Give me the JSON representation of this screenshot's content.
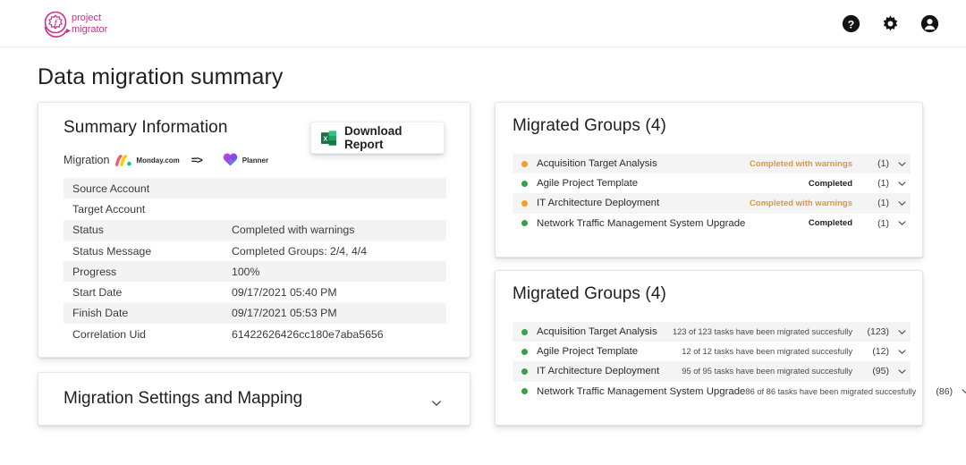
{
  "header": {
    "logo": {
      "line1": "project",
      "line2": "migrator",
      "color": "#cf2d87"
    },
    "icons": [
      {
        "name": "help-icon",
        "glyph": "?"
      },
      {
        "name": "gear-icon",
        "glyph": "gear"
      },
      {
        "name": "account-icon",
        "glyph": "person"
      }
    ]
  },
  "page": {
    "title": "Data migration summary"
  },
  "summary": {
    "title": "Summary Information",
    "download_label": "Download Report",
    "download_icon": "excel-icon",
    "migration_label": "Migration",
    "source_product": "Monday.com",
    "arrow": "=>",
    "target_product": "Planner",
    "rows": [
      {
        "key": "Source Account",
        "value": ""
      },
      {
        "key": "Target Account",
        "value": ""
      },
      {
        "key": "Status",
        "value": "Completed with warnings"
      },
      {
        "key": "Status Message",
        "value": "Completed Groups: 2/4, 4/4"
      },
      {
        "key": "Progress",
        "value": "100%"
      },
      {
        "key": "Start Date",
        "value": "09/17/2021 05:40 PM"
      },
      {
        "key": "Finish Date",
        "value": "09/17/2021 05:53 PM"
      },
      {
        "key": "Correlation Uid",
        "value": "61422626426cc180e7aba5656"
      }
    ]
  },
  "settings": {
    "title": "Migration Settings and Mapping",
    "chevron": "chevron-down-icon"
  },
  "groups_status": {
    "title": "Migrated Groups (4)",
    "rows": [
      {
        "name": "Acquisition Target Analysis",
        "status": "Completed with warnings",
        "state": "warn",
        "count": "(1)"
      },
      {
        "name": "Agile Project Template",
        "status": "Completed",
        "state": "ok",
        "count": "(1)"
      },
      {
        "name": "IT Architecture Deployment",
        "status": "Completed with warnings",
        "state": "warn",
        "count": "(1)"
      },
      {
        "name": "Network Traffic Management System Upgrade",
        "status": "Completed",
        "state": "ok",
        "count": "(1)"
      }
    ]
  },
  "groups_tasks": {
    "title": "Migrated Groups (4)",
    "rows": [
      {
        "name": "Acquisition Target Analysis",
        "status": "123 of 123 tasks have been migrated succesfully",
        "state": "ok",
        "count": "(123)"
      },
      {
        "name": "Agile Project Template",
        "status": "12 of 12 tasks have been migrated succesfully",
        "state": "ok",
        "count": "(12)"
      },
      {
        "name": "IT Architecture Deployment",
        "status": "95 of 95 tasks have been migrated succesfully",
        "state": "ok",
        "count": "(95)"
      },
      {
        "name": "Network Traffic Management System Upgrade",
        "status": "86 of 86 tasks have been migrated succesfully",
        "state": "ok",
        "count": "(86)"
      }
    ]
  },
  "colors": {
    "brand": "#cf2d87",
    "warning": "#f2a128",
    "warning_text": "#d89a3c",
    "success": "#35a14a",
    "excel_green": "#1d7044",
    "row_alt": "#f3f3f3"
  }
}
